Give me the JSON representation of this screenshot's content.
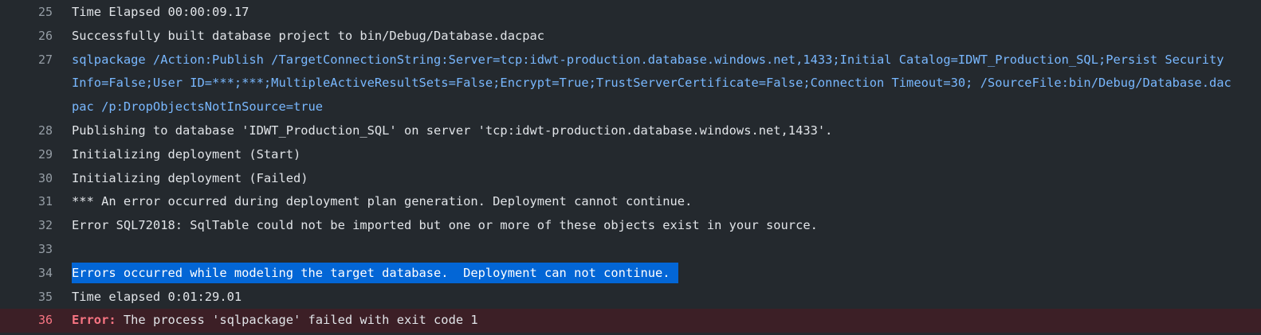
{
  "log": {
    "lines": [
      {
        "number": "25",
        "text": "Time Elapsed 00:00:09.17"
      },
      {
        "number": "26",
        "text": "Successfully built database project to bin/Debug/Database.dacpac"
      },
      {
        "number": "27",
        "text": "sqlpackage /Action:Publish /TargetConnectionString:Server=tcp:idwt-production.database.windows.net,1433;Initial Catalog=IDWT_Production_SQL;Persist Security Info=False;User ID=***;***;MultipleActiveResultSets=False;Encrypt=True;TrustServerCertificate=False;Connection Timeout=30; /SourceFile:bin/Debug/Database.dacpac /p:DropObjectsNotInSource=true"
      },
      {
        "number": "28",
        "text": "Publishing to database 'IDWT_Production_SQL' on server 'tcp:idwt-production.database.windows.net,1433'."
      },
      {
        "number": "29",
        "text": "Initializing deployment (Start)"
      },
      {
        "number": "30",
        "text": "Initializing deployment (Failed)"
      },
      {
        "number": "31",
        "text": "*** An error occurred during deployment plan generation. Deployment cannot continue."
      },
      {
        "number": "32",
        "text": "Error SQL72018: SqlTable could not be imported but one or more of these objects exist in your source."
      },
      {
        "number": "33",
        "text": ""
      },
      {
        "number": "34",
        "text": "Errors occurred while modeling the target database.  Deployment can not continue."
      },
      {
        "number": "35",
        "text": "Time elapsed 0:01:29.01"
      },
      {
        "number": "36",
        "error_label": "Error:",
        "text": " The process 'sqlpackage' failed with exit code 1"
      }
    ]
  },
  "colors": {
    "background": "#24292e",
    "command": "#79b8ff",
    "selection": "#0366d6",
    "error": "#f97583"
  }
}
